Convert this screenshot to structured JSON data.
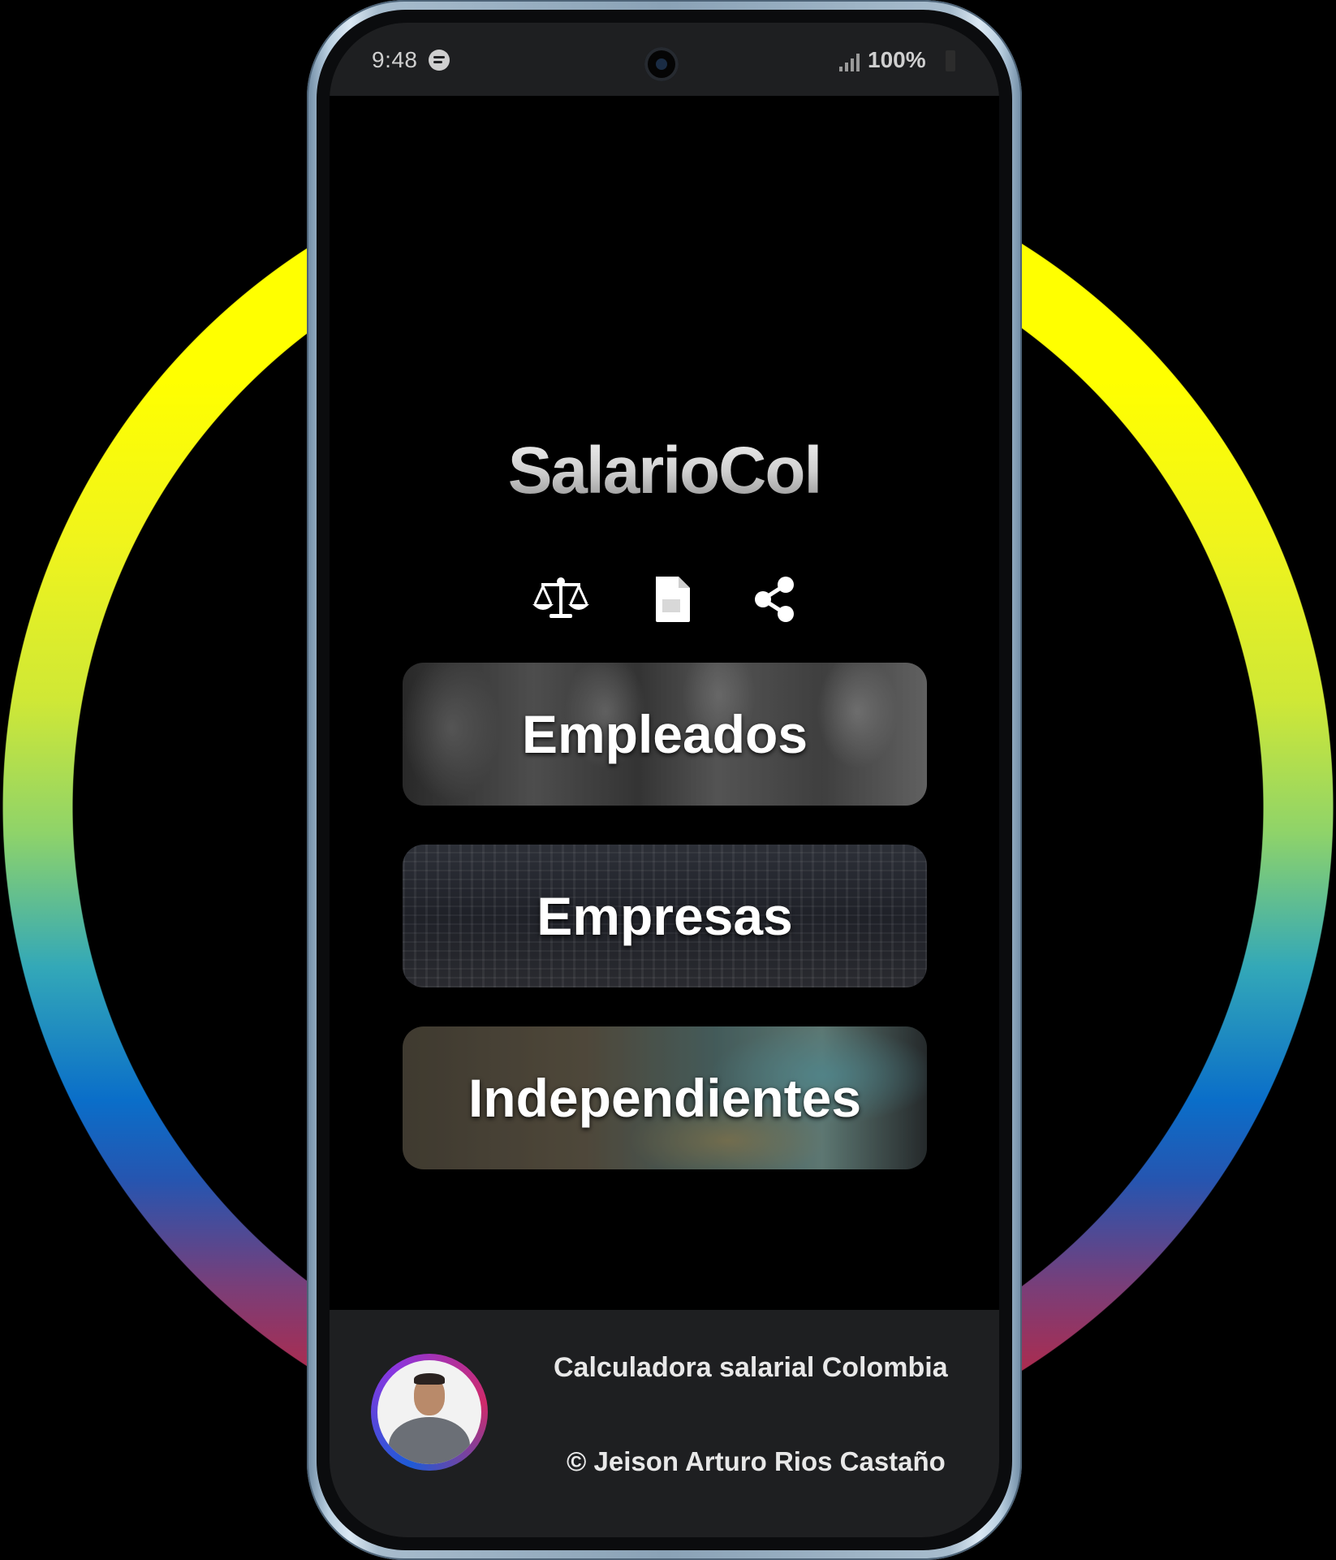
{
  "status_bar": {
    "time": "9:48",
    "battery": "100%",
    "app_icon": "spotify-icon",
    "signal_icon": "signal-icon",
    "battery_icon": "battery-icon"
  },
  "app": {
    "logo": "SalarioCol",
    "icons": [
      "scale-icon",
      "document-icon",
      "share-icon"
    ]
  },
  "menu": {
    "items": [
      {
        "label": "Empleados"
      },
      {
        "label": "Empresas"
      },
      {
        "label": "Independientes"
      }
    ]
  },
  "footer": {
    "title": "Calculadora salarial Colombia",
    "author": "© Jeison Arturo Rios Castaño"
  },
  "colors": {
    "ring_top": "#ffff00",
    "ring_middle": "#0a6ec9",
    "ring_bottom": "#d21c30",
    "screen_background": "#000000",
    "bar_background": "#1e1f21"
  }
}
